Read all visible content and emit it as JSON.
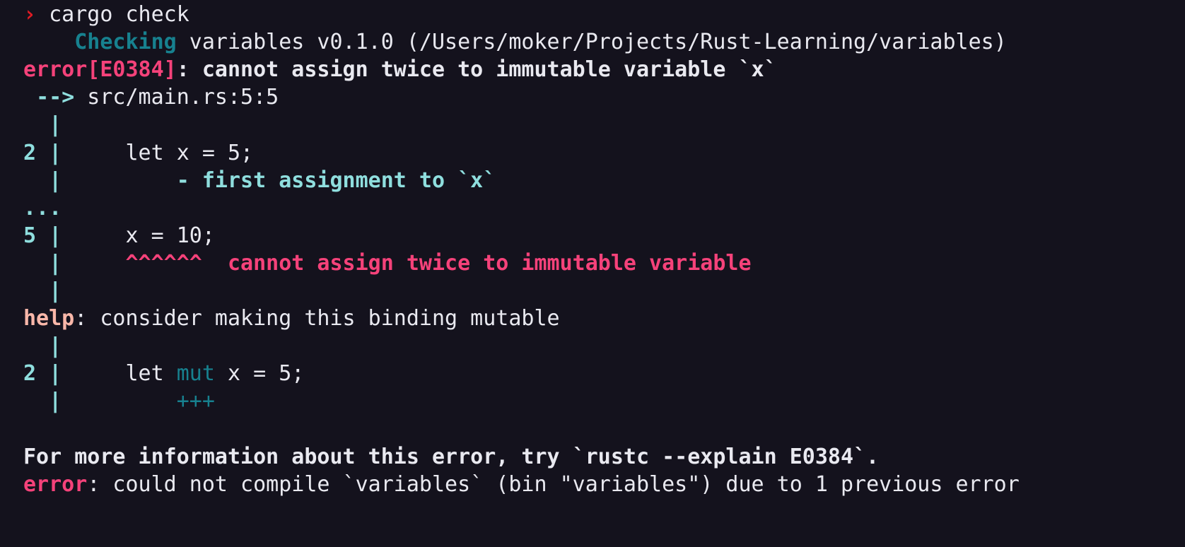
{
  "terminal": {
    "background_color": "#14121d",
    "foreground_color": "#e9e9f0",
    "colors": {
      "prompt_red": "#e01b24",
      "checking_teal": "#17818f",
      "error_pink": "#f5427a",
      "gutter_cyan": "#8fdede",
      "help_salmon": "#f9b7a9",
      "suggestion_teal": "#17818f"
    },
    "prompt_symbol": "›",
    "command": "cargo check"
  },
  "lines": [
    {
      "id": "prompt-line",
      "segments": [
        {
          "text": "›",
          "color": "prompt_red",
          "bold": true
        },
        {
          "text": " cargo check",
          "color": "foreground",
          "bold": false
        }
      ]
    },
    {
      "id": "checking-line",
      "segments": [
        {
          "text": "    ",
          "color": "foreground",
          "bold": false
        },
        {
          "text": "Checking",
          "color": "checking_teal",
          "bold": true
        },
        {
          "text": " variables v0.1.0 (/Users/moker/Projects/Rust-Learning/variables)",
          "color": "foreground",
          "bold": false
        }
      ]
    },
    {
      "id": "error-header-line",
      "segments": [
        {
          "text": "error[E0384]",
          "color": "error_pink",
          "bold": true
        },
        {
          "text": ": cannot assign twice to immutable variable `x`",
          "color": "foreground",
          "bold": true
        }
      ]
    },
    {
      "id": "location-line",
      "segments": [
        {
          "text": " ",
          "color": "foreground",
          "bold": false
        },
        {
          "text": "-->",
          "color": "gutter_cyan",
          "bold": true
        },
        {
          "text": " src/main.rs:5:5",
          "color": "foreground",
          "bold": false
        }
      ]
    },
    {
      "id": "gutter-bar-1",
      "segments": [
        {
          "text": "  |",
          "color": "gutter_cyan",
          "bold": true
        }
      ]
    },
    {
      "id": "source-line-2",
      "segments": [
        {
          "text": "2 |",
          "color": "gutter_cyan",
          "bold": true
        },
        {
          "text": "     let x = 5;",
          "color": "foreground",
          "bold": false
        }
      ]
    },
    {
      "id": "first-assignment-label",
      "segments": [
        {
          "text": "  |",
          "color": "gutter_cyan",
          "bold": true
        },
        {
          "text": "         - first assignment to `x`",
          "color": "gutter_cyan",
          "bold": true
        }
      ]
    },
    {
      "id": "ellipsis-line",
      "segments": [
        {
          "text": "...",
          "color": "gutter_cyan",
          "bold": true
        }
      ]
    },
    {
      "id": "source-line-5",
      "segments": [
        {
          "text": "5 |",
          "color": "gutter_cyan",
          "bold": true
        },
        {
          "text": "     x = 10;",
          "color": "foreground",
          "bold": false
        }
      ]
    },
    {
      "id": "caret-line",
      "segments": [
        {
          "text": "  |",
          "color": "gutter_cyan",
          "bold": true
        },
        {
          "text": "     ^^^^^^",
          "color": "error_pink",
          "bold": true
        },
        {
          "text": "  cannot assign twice to immutable variable",
          "color": "error_pink",
          "bold": true
        }
      ]
    },
    {
      "id": "gutter-bar-2",
      "segments": [
        {
          "text": "  |",
          "color": "gutter_cyan",
          "bold": true
        }
      ]
    },
    {
      "id": "help-line",
      "segments": [
        {
          "text": "help",
          "color": "help_salmon",
          "bold": true
        },
        {
          "text": ": consider making this binding mutable",
          "color": "foreground",
          "bold": false
        }
      ]
    },
    {
      "id": "gutter-bar-3",
      "segments": [
        {
          "text": "  |",
          "color": "gutter_cyan",
          "bold": true
        }
      ]
    },
    {
      "id": "suggestion-line-2",
      "segments": [
        {
          "text": "2 |",
          "color": "gutter_cyan",
          "bold": true
        },
        {
          "text": "     let ",
          "color": "foreground",
          "bold": false
        },
        {
          "text": "mut",
          "color": "suggestion_teal",
          "bold": false
        },
        {
          "text": " x = 5;",
          "color": "foreground",
          "bold": false
        }
      ]
    },
    {
      "id": "plus-marker-line",
      "segments": [
        {
          "text": "  |",
          "color": "gutter_cyan",
          "bold": true
        },
        {
          "text": "         +++",
          "color": "suggestion_teal",
          "bold": false
        }
      ]
    },
    {
      "id": "blank-line-1",
      "segments": []
    },
    {
      "id": "more-info-line",
      "segments": [
        {
          "text": "For more information about this error, try `rustc --explain E0384`.",
          "color": "foreground",
          "bold": true
        }
      ]
    },
    {
      "id": "final-error-line",
      "segments": [
        {
          "text": "error",
          "color": "error_pink",
          "bold": true
        },
        {
          "text": ": could not compile `variables` (bin \"variables\") due to 1 previous error",
          "color": "foreground",
          "bold": false
        }
      ]
    }
  ]
}
